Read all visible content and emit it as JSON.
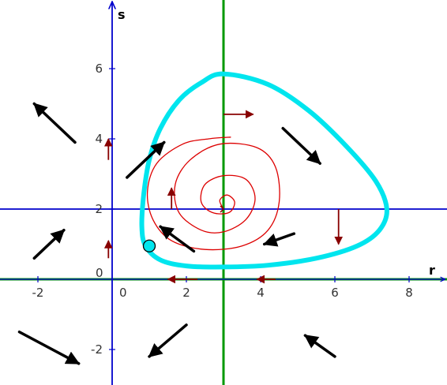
{
  "axes": {
    "x_label": "r",
    "y_label": "s",
    "x_range": [
      -3,
      9
    ],
    "y_range": [
      -3,
      8
    ],
    "x_ticks": [
      {
        "value": -2,
        "label": "-2"
      },
      {
        "value": 2,
        "label": "2"
      },
      {
        "value": 4,
        "label": "4"
      },
      {
        "value": 6,
        "label": "6"
      },
      {
        "value": 8,
        "label": "8"
      }
    ],
    "y_ticks": [
      {
        "value": -2,
        "label": "-2"
      },
      {
        "value": 2,
        "label": "2"
      },
      {
        "value": 4,
        "label": "4"
      },
      {
        "value": 6,
        "label": "6"
      }
    ],
    "origin_x_label": "0",
    "origin_y_label": "0",
    "axis_color": "#0000cc"
  },
  "nullclines": {
    "vertical_green": {
      "r": 3,
      "color": "#009900"
    },
    "horizontal_green": {
      "s": 0,
      "color": "#009900"
    },
    "horizontal_blue": {
      "s": 2,
      "color": "#0000cc"
    }
  },
  "direction_field": {
    "color": "#000000",
    "arrows": [
      {
        "from": [
          -1.0,
          3.9
        ],
        "to": [
          -2.1,
          5.0
        ]
      },
      {
        "from": [
          -2.1,
          0.6
        ],
        "to": [
          -1.3,
          1.4
        ]
      },
      {
        "from": [
          -2.5,
          -1.5
        ],
        "to": [
          -0.9,
          -2.4
        ]
      },
      {
        "from": [
          0.4,
          2.9
        ],
        "to": [
          1.4,
          3.9
        ]
      },
      {
        "from": [
          2.2,
          0.8
        ],
        "to": [
          1.3,
          1.5
        ]
      },
      {
        "from": [
          2.0,
          -1.3
        ],
        "to": [
          1.0,
          -2.2
        ]
      },
      {
        "from": [
          4.6,
          4.3
        ],
        "to": [
          5.6,
          3.3
        ]
      },
      {
        "from": [
          4.9,
          1.3
        ],
        "to": [
          4.1,
          1.0
        ]
      },
      {
        "from": [
          6.0,
          -2.2
        ],
        "to": [
          5.2,
          -1.6
        ]
      }
    ]
  },
  "nullcline_arrows": {
    "color": "#880000",
    "arrows": [
      {
        "from": [
          3.0,
          4.7
        ],
        "to": [
          3.8,
          4.7
        ]
      },
      {
        "from": [
          6.1,
          2.0
        ],
        "to": [
          6.1,
          1.0
        ]
      },
      {
        "from": [
          4.4,
          0.0
        ],
        "to": [
          3.9,
          0.0
        ]
      },
      {
        "from": [
          2.3,
          0.0
        ],
        "to": [
          1.5,
          0.0
        ]
      },
      {
        "from": [
          -0.1,
          3.4
        ],
        "to": [
          -0.1,
          4.0
        ]
      },
      {
        "from": [
          -0.1,
          0.6
        ],
        "to": [
          -0.1,
          1.1
        ]
      },
      {
        "from": [
          1.6,
          2.0
        ],
        "to": [
          1.6,
          2.6
        ]
      },
      {
        "from": [
          3.0,
          2.0
        ],
        "to": [
          3.0,
          2.0
        ]
      }
    ]
  },
  "limit_cycle": {
    "color": "#00e5ee",
    "points": [
      [
        3.0,
        5.85
      ],
      [
        4.2,
        5.55
      ],
      [
        5.3,
        4.8
      ],
      [
        6.3,
        3.8
      ],
      [
        7.1,
        2.8
      ],
      [
        7.4,
        2.0
      ],
      [
        7.2,
        1.4
      ],
      [
        6.6,
        0.95
      ],
      [
        5.5,
        0.6
      ],
      [
        4.2,
        0.4
      ],
      [
        3.0,
        0.35
      ],
      [
        2.0,
        0.38
      ],
      [
        1.3,
        0.55
      ],
      [
        0.9,
        0.95
      ],
      [
        0.8,
        1.5
      ],
      [
        0.85,
        2.4
      ],
      [
        1.0,
        3.4
      ],
      [
        1.3,
        4.3
      ],
      [
        1.8,
        5.1
      ],
      [
        2.4,
        5.6
      ],
      [
        3.0,
        5.85
      ]
    ],
    "marker": {
      "point": [
        1.0,
        0.95
      ],
      "color": "#00e5ee"
    }
  },
  "trajectory": {
    "color": "#dd0000",
    "points": [
      [
        3.0,
        2.0
      ],
      [
        2.9,
        2.25
      ],
      [
        3.1,
        2.4
      ],
      [
        3.3,
        2.2
      ],
      [
        3.15,
        1.9
      ],
      [
        2.7,
        1.9
      ],
      [
        2.4,
        2.2
      ],
      [
        2.5,
        2.7
      ],
      [
        3.0,
        2.95
      ],
      [
        3.6,
        2.85
      ],
      [
        3.85,
        2.3
      ],
      [
        3.6,
        1.7
      ],
      [
        3.0,
        1.35
      ],
      [
        2.4,
        1.4
      ],
      [
        1.8,
        1.9
      ],
      [
        1.7,
        2.7
      ],
      [
        2.1,
        3.4
      ],
      [
        2.9,
        3.85
      ],
      [
        3.9,
        3.75
      ],
      [
        4.4,
        3.2
      ],
      [
        4.5,
        2.2
      ],
      [
        4.2,
        1.4
      ],
      [
        3.5,
        0.95
      ],
      [
        2.5,
        0.85
      ],
      [
        1.6,
        1.1
      ],
      [
        1.1,
        1.7
      ],
      [
        0.95,
        2.5
      ],
      [
        1.2,
        3.3
      ],
      [
        1.9,
        3.85
      ],
      [
        2.6,
        4.0
      ],
      [
        3.2,
        4.05
      ]
    ]
  }
}
